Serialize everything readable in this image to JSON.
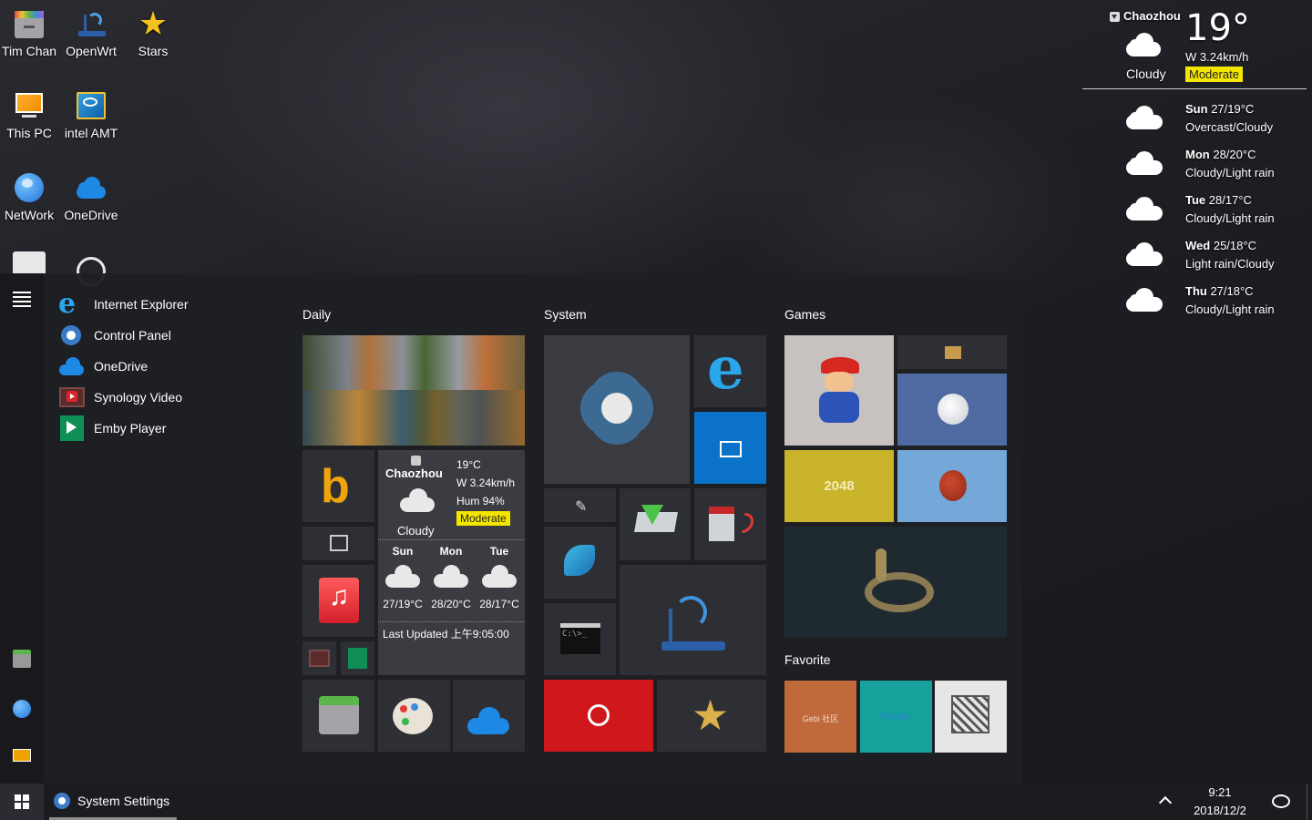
{
  "desktop": {
    "icons": [
      {
        "label": "Tim Chan",
        "icon": "archive-icon"
      },
      {
        "label": "OpenWrt",
        "icon": "router-icon"
      },
      {
        "label": "Stars",
        "icon": "star-icon"
      },
      {
        "label": "This PC",
        "icon": "monitor-icon"
      },
      {
        "label": "intel AMT",
        "icon": "intel-xeon-icon"
      },
      {
        "label": "NetWork",
        "icon": "globe-icon"
      },
      {
        "label": "OneDrive",
        "icon": "cloud-icon"
      }
    ]
  },
  "weather": {
    "city": "Chaozhou",
    "temp": "19°",
    "condition": "Cloudy",
    "wind": "W 3.24km/h",
    "aqi": "Moderate",
    "forecast": [
      {
        "day": "Sun",
        "range": "27/19°C",
        "desc": "Overcast/Cloudy"
      },
      {
        "day": "Mon",
        "range": "28/20°C",
        "desc": "Cloudy/Light rain"
      },
      {
        "day": "Tue",
        "range": "28/17°C",
        "desc": "Cloudy/Light rain"
      },
      {
        "day": "Wed",
        "range": "25/18°C",
        "desc": "Light rain/Cloudy"
      },
      {
        "day": "Thu",
        "range": "27/18°C",
        "desc": "Cloudy/Light rain"
      }
    ]
  },
  "start_menu": {
    "apps": [
      {
        "label": "Internet Explorer",
        "icon": "ie-icon"
      },
      {
        "label": "Control Panel",
        "icon": "gear-icon"
      },
      {
        "label": "OneDrive",
        "icon": "cloud-icon"
      },
      {
        "label": "Synology Video",
        "icon": "video-icon"
      },
      {
        "label": "Emby Player",
        "icon": "play-icon"
      }
    ],
    "groups": {
      "daily": "Daily",
      "system": "System",
      "games": "Games",
      "favorite": "Favorite"
    },
    "weather_tile": {
      "city": "Chaozhou",
      "temp": "19°C",
      "wind": "W 3.24km/h",
      "humidity": "Hum 94%",
      "aqi": "Moderate",
      "condition": "Cloudy",
      "days": [
        {
          "day": "Sun",
          "range": "27/19°C"
        },
        {
          "day": "Mon",
          "range": "28/20°C"
        },
        {
          "day": "Tue",
          "range": "28/17°C"
        }
      ],
      "updated": "Last Updated 上午9:05:00"
    },
    "game_tiles": {
      "number_game": "2048"
    },
    "favorite_tiles": {
      "gebi": "Gebi 社区",
      "tile2": "Feiyuan"
    }
  },
  "taskbar": {
    "active_app": "System Settings",
    "time": "9:21",
    "date": "2018/12/2"
  },
  "colors": {
    "accent_blue": "#0a72c8",
    "aqi_yellow": "#f2e500",
    "tile_red": "#d0171b",
    "tile_yellow": "#c9b32a"
  }
}
